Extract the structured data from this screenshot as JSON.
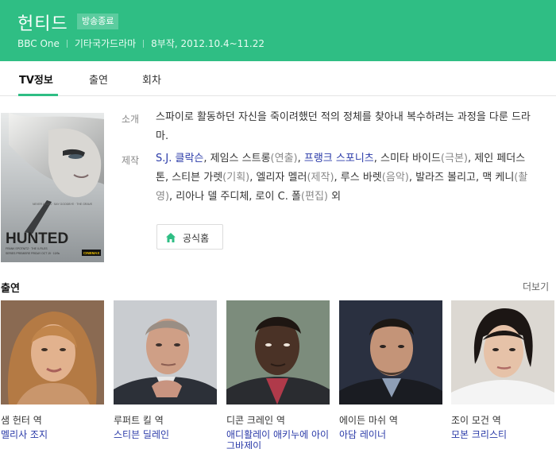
{
  "header": {
    "title": "헌티드",
    "badge": "방송종료",
    "channel": "BBC One",
    "genre": "기타국가드라마",
    "episodes_dates": "8부작, 2012.10.4~11.22",
    "bg_color": "#2fbe84"
  },
  "tabs": [
    {
      "label": "TV정보",
      "active": true
    },
    {
      "label": "출연",
      "active": false
    },
    {
      "label": "회차",
      "active": false
    }
  ],
  "poster": {
    "title_text": "HUNTED",
    "top_lines": "NEVER AGAIN · SAY GOODBYE · THE GRAVE",
    "bottom_line": "SERIES PREMIERE FRIDAY OCT 19 · 10/9c",
    "network": "CINEMAX",
    "credits": "FRANK SPOTNITZ · THE X-FILES"
  },
  "intro": {
    "label": "소개",
    "text": "스파이로 활동하던 자신을 죽이려했던 적의 정체를 찾아내 복수하려는 과정을 다룬 드라마."
  },
  "production": {
    "label": "제작",
    "segments": [
      {
        "text": "S.J. 클락슨",
        "link": true
      },
      {
        "text": ", 제임스 스트롱",
        "link": false
      },
      {
        "text": "(연출)",
        "role": true
      },
      {
        "text": ", ",
        "link": false
      },
      {
        "text": "프랭크 스포니츠",
        "link": true
      },
      {
        "text": ", 스미타 바이드",
        "link": false
      },
      {
        "text": "(극본)",
        "role": true
      },
      {
        "text": ", 제인 페더스톤, 스티븐 가렛",
        "link": false
      },
      {
        "text": "(기획)",
        "role": true
      },
      {
        "text": ", 엘리자 멜러",
        "link": false
      },
      {
        "text": "(제작)",
        "role": true
      },
      {
        "text": ", 루스 바렛",
        "link": false
      },
      {
        "text": "(음악)",
        "role": true
      },
      {
        "text": ", 발라즈 볼리고, 맥 케니",
        "link": false
      },
      {
        "text": "(촬영)",
        "role": true
      },
      {
        "text": ", 리아나 델 주디체, 로이 C. 폴",
        "link": false
      },
      {
        "text": "(편집)",
        "role": true
      },
      {
        "text": " 외",
        "link": false
      }
    ]
  },
  "official_button": {
    "label": "공식홈",
    "icon": "home-icon"
  },
  "cast_section": {
    "title": "출연",
    "more_label": "더보기",
    "items": [
      {
        "role": "샘 헌터 역",
        "actor": "멜리사 조지"
      },
      {
        "role": "루퍼트 킬 역",
        "actor": "스티븐 딜레인"
      },
      {
        "role": "디콘 크레인 역",
        "actor": "애디활레이 애키누에 아이그바제이"
      },
      {
        "role": "에이든 마쉬 역",
        "actor": "아담 레이너"
      },
      {
        "role": "조이 모건 역",
        "actor": "모본 크리스티"
      }
    ]
  },
  "colors": {
    "accent": "#2fbe84",
    "link": "#2a3aa8"
  }
}
